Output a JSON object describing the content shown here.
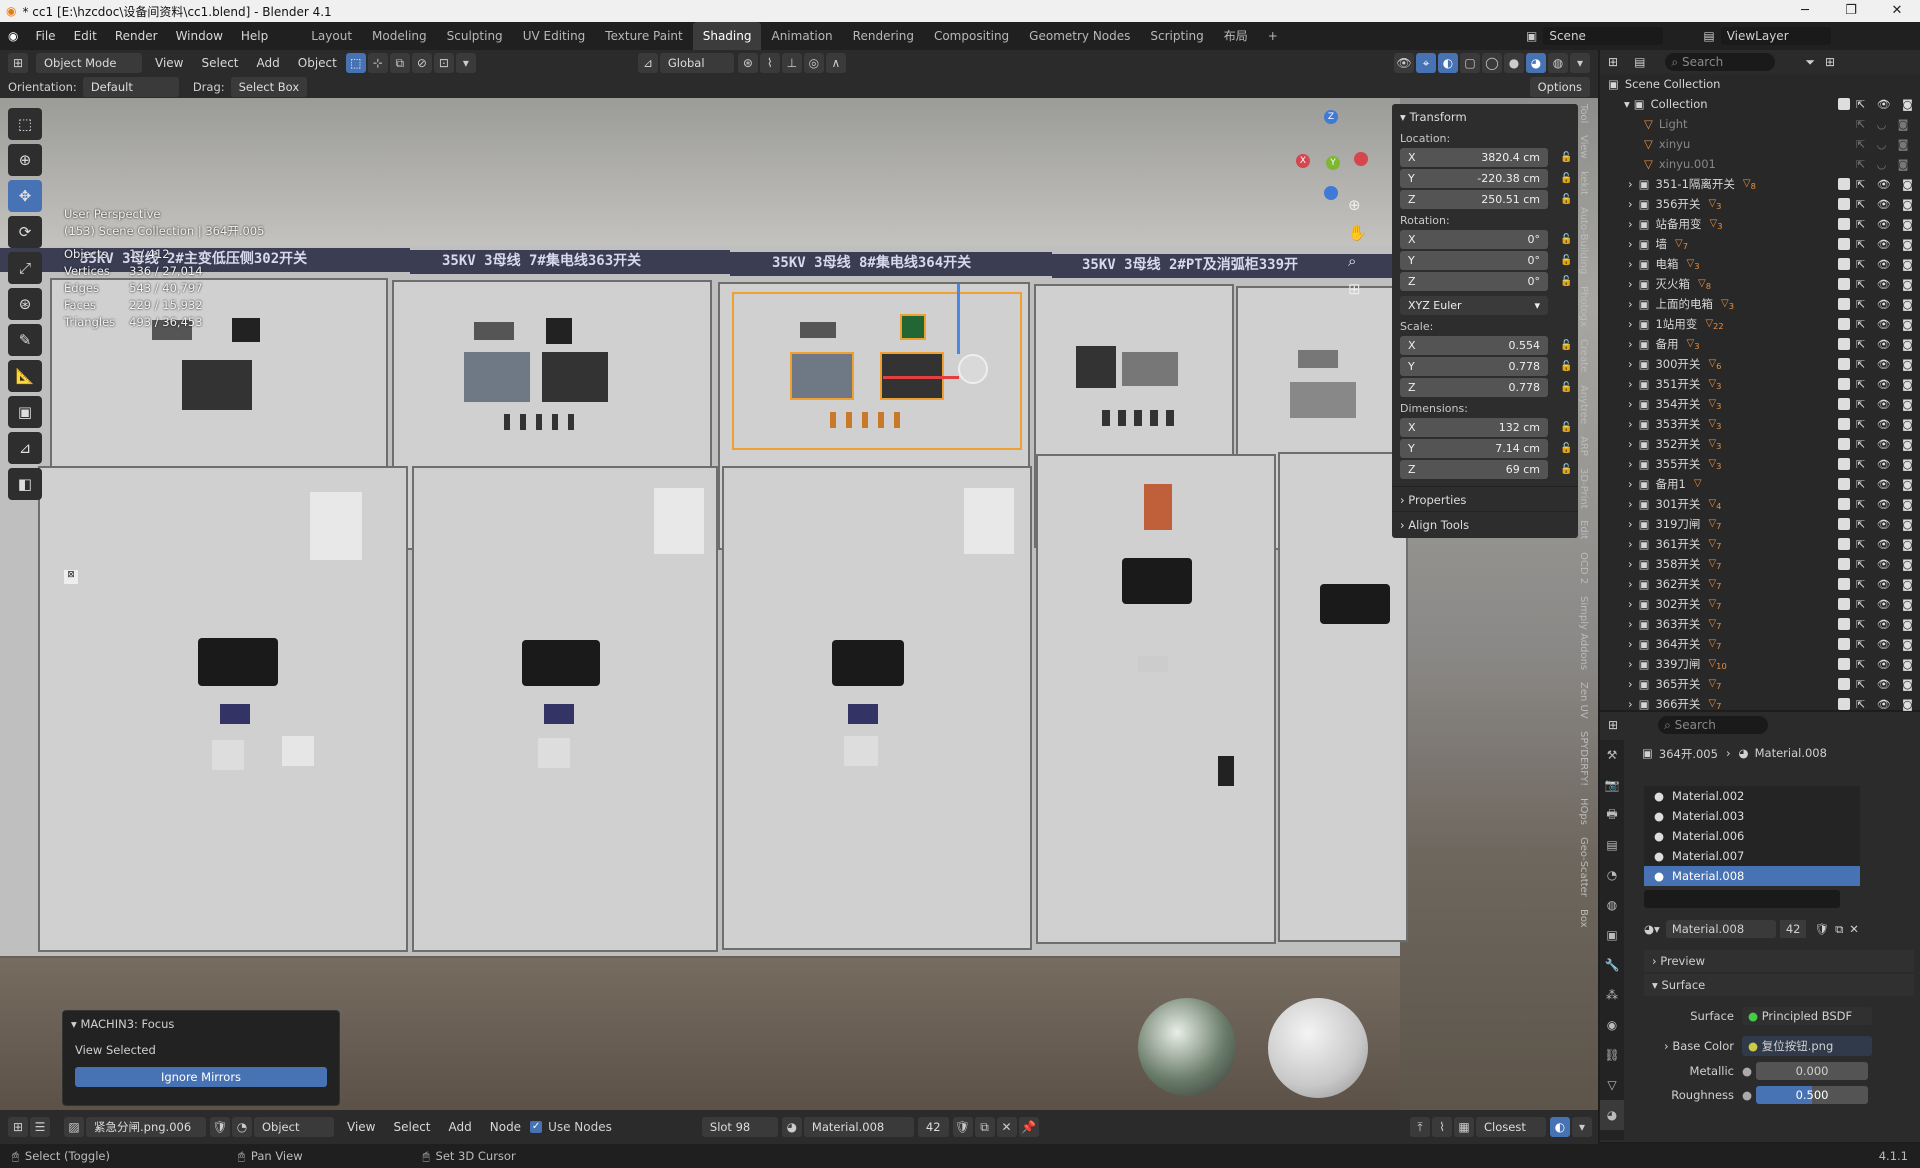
{
  "window": {
    "title": "* cc1 [E:\\hzcdoc\\设备间资料\\cc1.blend] - Blender 4.1",
    "min": "─",
    "max": "❐",
    "close": "✕"
  },
  "menu": [
    "File",
    "Edit",
    "Render",
    "Window",
    "Help"
  ],
  "workspaces": [
    {
      "label": "Layout",
      "active": false
    },
    {
      "label": "Modeling",
      "active": false
    },
    {
      "label": "Sculpting",
      "active": false
    },
    {
      "label": "UV Editing",
      "active": false
    },
    {
      "label": "Texture Paint",
      "active": false
    },
    {
      "label": "Shading",
      "active": true
    },
    {
      "label": "Animation",
      "active": false
    },
    {
      "label": "Rendering",
      "active": false
    },
    {
      "label": "Compositing",
      "active": false
    },
    {
      "label": "Geometry Nodes",
      "active": false
    },
    {
      "label": "Scripting",
      "active": false
    },
    {
      "label": "布局",
      "active": false
    },
    {
      "label": "+",
      "active": false
    }
  ],
  "scene": {
    "label": "Scene",
    "viewlayer": "ViewLayer"
  },
  "header": {
    "mode": "Object Mode",
    "view": "View",
    "select": "Select",
    "add": "Add",
    "object": "Object",
    "transform": "Global"
  },
  "header2": {
    "orientation_label": "Orientation:",
    "orientation_value": "Default",
    "drag_label": "Drag:",
    "drag_value": "Select Box",
    "options": "Options"
  },
  "stats": {
    "perspective": "User Perspective",
    "collection": "(153) Scene Collection | 364开.005",
    "rows": [
      {
        "k": "Objects",
        "v": "1 / 412"
      },
      {
        "k": "Vertices",
        "v": "336 / 27,014"
      },
      {
        "k": "Edges",
        "v": "543 / 40,797"
      },
      {
        "k": "Faces",
        "v": "229 / 15,932"
      },
      {
        "k": "Triangles",
        "v": "493 / 36,453"
      }
    ]
  },
  "banners": [
    "35KV 3母线 2#主变低压侧302开关",
    "35KV 3母线 7#集电线363开关",
    "35KV 3母线 8#集电线364开关",
    "35KV 3母线 2#PT及消弧柜339开"
  ],
  "gizmo": {
    "x": "X",
    "y": "Y",
    "z": "Z"
  },
  "npanel": {
    "transform": "Transform",
    "location_label": "Location:",
    "location": [
      {
        "axis": "X",
        "value": "3820.4 cm"
      },
      {
        "axis": "Y",
        "value": "-220.38 cm"
      },
      {
        "axis": "Z",
        "value": "250.51 cm"
      }
    ],
    "rotation_label": "Rotation:",
    "rotation": [
      {
        "axis": "X",
        "value": "0°"
      },
      {
        "axis": "Y",
        "value": "0°"
      },
      {
        "axis": "Z",
        "value": "0°"
      }
    ],
    "euler": "XYZ Euler",
    "scale_label": "Scale:",
    "scale": [
      {
        "axis": "X",
        "value": "0.554"
      },
      {
        "axis": "Y",
        "value": "0.778"
      },
      {
        "axis": "Z",
        "value": "0.778"
      }
    ],
    "dimensions_label": "Dimensions:",
    "dimensions": [
      {
        "axis": "X",
        "value": "132 cm"
      },
      {
        "axis": "Y",
        "value": "7.14 cm"
      },
      {
        "axis": "Z",
        "value": "69 cm"
      }
    ],
    "properties": "Properties",
    "align_tools": "Align Tools"
  },
  "sidetabs": [
    "Tool",
    "View",
    "kekit",
    "Auto-Building",
    "Photogx",
    "Create",
    "Anytree",
    "ARP",
    "3D-Print",
    "Edit",
    "OCD 2",
    "Simply Addons",
    "Zen UV",
    "SPYDERFY!",
    "HOps",
    "Geo-Scatter",
    "Box"
  ],
  "outliner": {
    "search_placeholder": "Search",
    "root": "Scene Collection",
    "collection": "Collection",
    "children": [
      {
        "label": "Light",
        "badge": ""
      },
      {
        "label": "xinyu",
        "badge": ""
      },
      {
        "label": "xinyu.001",
        "badge": ""
      }
    ],
    "items": [
      {
        "label": "351-1隔离开关",
        "badge": "8"
      },
      {
        "label": "356开关",
        "badge": "3"
      },
      {
        "label": "站备用变",
        "badge": "3"
      },
      {
        "label": "墙",
        "badge": "7"
      },
      {
        "label": "电箱",
        "badge": "3"
      },
      {
        "label": "灭火箱",
        "badge": "8"
      },
      {
        "label": "上面的电箱",
        "badge": "3"
      },
      {
        "label": "1站用变",
        "badge": "22"
      },
      {
        "label": "备用",
        "badge": "3"
      },
      {
        "label": "300开关",
        "badge": "6"
      },
      {
        "label": "351开关",
        "badge": "3"
      },
      {
        "label": "354开关",
        "badge": "3"
      },
      {
        "label": "353开关",
        "badge": "3"
      },
      {
        "label": "352开关",
        "badge": "3"
      },
      {
        "label": "355开关",
        "badge": "3"
      },
      {
        "label": "备用1",
        "badge": ""
      },
      {
        "label": "301开关",
        "badge": "4"
      },
      {
        "label": "319刀闸",
        "badge": "7"
      },
      {
        "label": "361开关",
        "badge": "7"
      },
      {
        "label": "358开关",
        "badge": "7"
      },
      {
        "label": "362开关",
        "badge": "7"
      },
      {
        "label": "302开关",
        "badge": "7"
      },
      {
        "label": "363开关",
        "badge": "7"
      },
      {
        "label": "364开关",
        "badge": "7"
      },
      {
        "label": "339刀闸",
        "badge": "10"
      },
      {
        "label": "365开关",
        "badge": "7"
      },
      {
        "label": "366开关",
        "badge": "7"
      }
    ]
  },
  "props": {
    "search_placeholder": "Search",
    "breadcrumb_object": "364开.005",
    "breadcrumb_material": "Material.008",
    "materials": [
      "Material.002",
      "Material.003",
      "Material.006",
      "Material.007",
      "Material.008"
    ],
    "selected_material": "Material.008",
    "users": "42",
    "preview": "Preview",
    "surface_section": "Surface",
    "surface_label": "Surface",
    "surface_value": "Principled BSDF",
    "base_color_label": "Base Color",
    "base_color_value": "复位按钮.png",
    "metallic_label": "Metallic",
    "metallic_value": "0.000",
    "roughness_label": "Roughness",
    "roughness_value": "0.500",
    "roughness_level": 0.5
  },
  "bottom": {
    "image": "紧急分闸.png.006",
    "object": "Object",
    "view": "View",
    "select": "Select",
    "add": "Add",
    "node": "Node",
    "use_nodes": "Use Nodes",
    "slot": "Slot 98",
    "material": "Material.008",
    "users": "42",
    "closest": "Closest"
  },
  "focus": {
    "title": "MACHIN3: Focus",
    "label": "View Selected",
    "button": "Ignore Mirrors"
  },
  "status": {
    "select": "Select (Toggle)",
    "pan": "Pan View",
    "cursor": "Set 3D Cursor",
    "version": "4.1.1"
  }
}
